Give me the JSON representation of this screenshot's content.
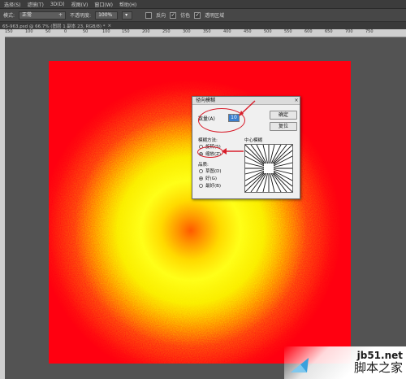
{
  "menubar": {
    "items": [
      "选择(S)",
      "滤镜(T)",
      "3D(D)",
      "视图(V)",
      "窗口(W)",
      "帮助(H)"
    ]
  },
  "options": {
    "mode_label": "模式:",
    "mode_value": "正常",
    "opacity_label": "不透明度:",
    "opacity_value": "100%",
    "reverse_label": "反向",
    "dither_label": "仿色",
    "transparency_label": "透明区域"
  },
  "tab": {
    "title": "65-963.psd @ 66.7% (图层 1 副本 23, RGB/8) *",
    "close": "×"
  },
  "ruler": {
    "marks": [
      "",
      "150",
      "100",
      "50",
      "0",
      "50",
      "100",
      "150",
      "200",
      "250",
      "300",
      "350",
      "400",
      "450",
      "500",
      "550",
      "600",
      "650",
      "700",
      "750"
    ]
  },
  "dialog": {
    "title": "径向模糊",
    "close": "×",
    "amount_label": "数量(A)",
    "amount_value": "10",
    "ok_label": "确定",
    "reset_label": "复位",
    "method_label": "模糊方法:",
    "method_spin": "旋转(S)",
    "method_zoom": "缩放(Z)",
    "quality_label": "品质:",
    "quality_draft": "草图(D)",
    "quality_good": "好(G)",
    "quality_best": "最好(B)",
    "center_label": "中心模糊"
  },
  "watermark": {
    "site": "jb51.net",
    "name": "脚本之家"
  },
  "colors": {
    "canvas_red": "#ff0010",
    "canvas_center": "#ff5a00",
    "highlight": "#d81d2a"
  }
}
